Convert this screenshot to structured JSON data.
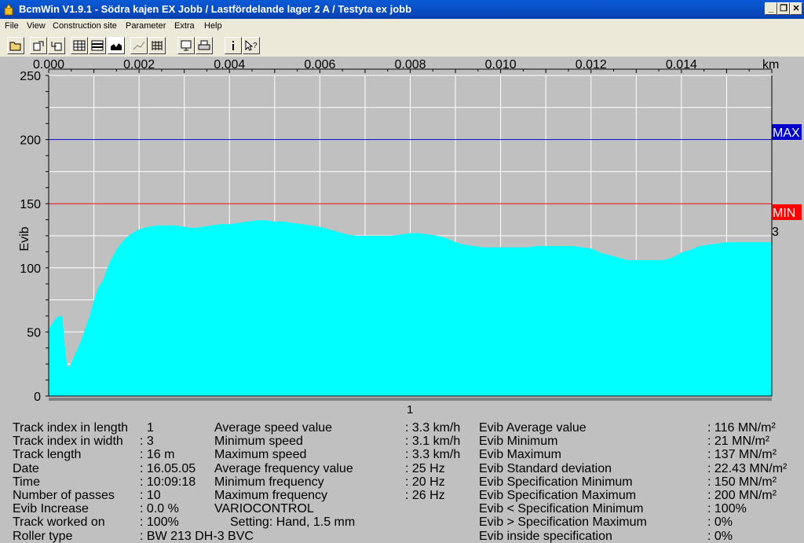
{
  "window": {
    "title": "BcmWin V1.9.1 - Södra kajen EX Jobb / Lastfördelande lager 2 A / Testyta ex jobb"
  },
  "menu": [
    "File",
    "View",
    "Construction site",
    "Parameter",
    "Extra",
    "Help"
  ],
  "toolbar_icons": [
    "open-icon",
    "export-icon",
    "import-icon",
    "grid-view-icon",
    "rows-view-icon",
    "area-chart-icon",
    "line-chart-icon",
    "table-icon",
    "monitor-icon",
    "print-icon",
    "info-icon",
    "help-pointer-icon"
  ],
  "chart_data": {
    "type": "area",
    "xlabel": "km",
    "ylabel": "Evib",
    "x_ticks": [
      "0.000",
      "0.002",
      "0.004",
      "0.006",
      "0.008",
      "0.010",
      "0.012",
      "0.014"
    ],
    "y_ticks": [
      "0",
      "50",
      "100",
      "150",
      "200",
      "250"
    ],
    "xlim": [
      0,
      0.016
    ],
    "ylim": [
      0,
      250
    ],
    "grid": true,
    "fill_color": "#00ffff",
    "max_line": {
      "label": "MAX",
      "value": 200,
      "color": "#0000cc"
    },
    "min_line": {
      "label": "MIN",
      "value": 150,
      "color": "#e00000"
    },
    "track_marker": "1",
    "side_marker": "3",
    "series": [
      {
        "x": [
          0,
          0.0001,
          0.0002,
          0.0003,
          0.00035,
          0.0004,
          0.00045,
          0.0005,
          0.0006,
          0.0007,
          0.0008,
          0.0009,
          0.001,
          0.0011,
          0.0012,
          0.0013,
          0.0014,
          0.0015,
          0.0016,
          0.0017,
          0.0018,
          0.002,
          0.0022,
          0.0024,
          0.0026,
          0.0028,
          0.003,
          0.0032,
          0.0034,
          0.0036,
          0.0038,
          0.004,
          0.0042,
          0.0044,
          0.0046,
          0.0048,
          0.005,
          0.0052,
          0.0054,
          0.0056,
          0.0058,
          0.006,
          0.0062,
          0.0064,
          0.0066,
          0.0068,
          0.007,
          0.0072,
          0.0074,
          0.0076,
          0.0078,
          0.008,
          0.0082,
          0.0084,
          0.0086,
          0.0088,
          0.009,
          0.0092,
          0.0094,
          0.0096,
          0.0098,
          0.01,
          0.0102,
          0.0104,
          0.0106,
          0.0108,
          0.011,
          0.0112,
          0.0114,
          0.0116,
          0.0118,
          0.012,
          0.0122,
          0.0124,
          0.0126,
          0.0128,
          0.013,
          0.0132,
          0.0134,
          0.0136,
          0.0138,
          0.014,
          0.0142,
          0.0144,
          0.0146,
          0.0148,
          0.015,
          0.0152,
          0.0154,
          0.0156,
          0.016
        ],
        "y": [
          52,
          58,
          62,
          62,
          42,
          25,
          22,
          26,
          34,
          42,
          52,
          62,
          75,
          85,
          90,
          100,
          108,
          114,
          119,
          123,
          126,
          130,
          132,
          133,
          133,
          133,
          132,
          131,
          132,
          133,
          134,
          134,
          135,
          136,
          137,
          137,
          136,
          136,
          135,
          134,
          133,
          132,
          130,
          128,
          126,
          125,
          125,
          125,
          125,
          125,
          126,
          127,
          127,
          126,
          125,
          123,
          120,
          118,
          117,
          116,
          116,
          116,
          116,
          116,
          116,
          117,
          117,
          117,
          117,
          117,
          116,
          115,
          112,
          110,
          108,
          106,
          106,
          106,
          106,
          106,
          108,
          112,
          114,
          117,
          118,
          119,
          120,
          120,
          120,
          120,
          120
        ]
      }
    ]
  },
  "stats": {
    "col1": {
      "labels": [
        "Track index in length",
        "Track index in width",
        "Track length",
        "Date",
        "Time",
        "Number of passes",
        "Evib Increase",
        "Track worked on",
        "Roller type"
      ],
      "values": [
        "1",
        ": 3",
        ": 16 m",
        ": 16.05.05",
        ": 10:09:18",
        ": 10",
        ": 0.0 %",
        ": 100%",
        ": BW 213 DH-3 BVC"
      ]
    },
    "col2": {
      "labels": [
        "Average speed value",
        "Minimum speed",
        "Maximum speed",
        "Average frequency value",
        "Minimum frequency",
        "Maximum frequency",
        "VARIOCONTROL",
        "Setting: Hand, 1.5 mm"
      ],
      "values": [
        ": 3.3 km/h",
        ": 3.1 km/h",
        ": 3.3 km/h",
        ": 25 Hz",
        ": 20 Hz",
        ": 26 Hz"
      ]
    },
    "col3": {
      "labels": [
        "Evib Average value",
        "Evib Minimum",
        "Evib Maximum",
        "Evib Standard deviation",
        "Evib Specification Minimum",
        "Evib Specification Maximum",
        "Evib < Specification Minimum",
        "Evib > Specification Maximum",
        "Evib inside specification"
      ],
      "values": [
        ": 116 MN/m²",
        ": 21 MN/m²",
        ": 137 MN/m²",
        ": 22.43 MN/m²",
        ": 150 MN/m²",
        ": 200 MN/m²",
        ": 100%",
        ": 0%",
        ": 0%"
      ]
    }
  }
}
